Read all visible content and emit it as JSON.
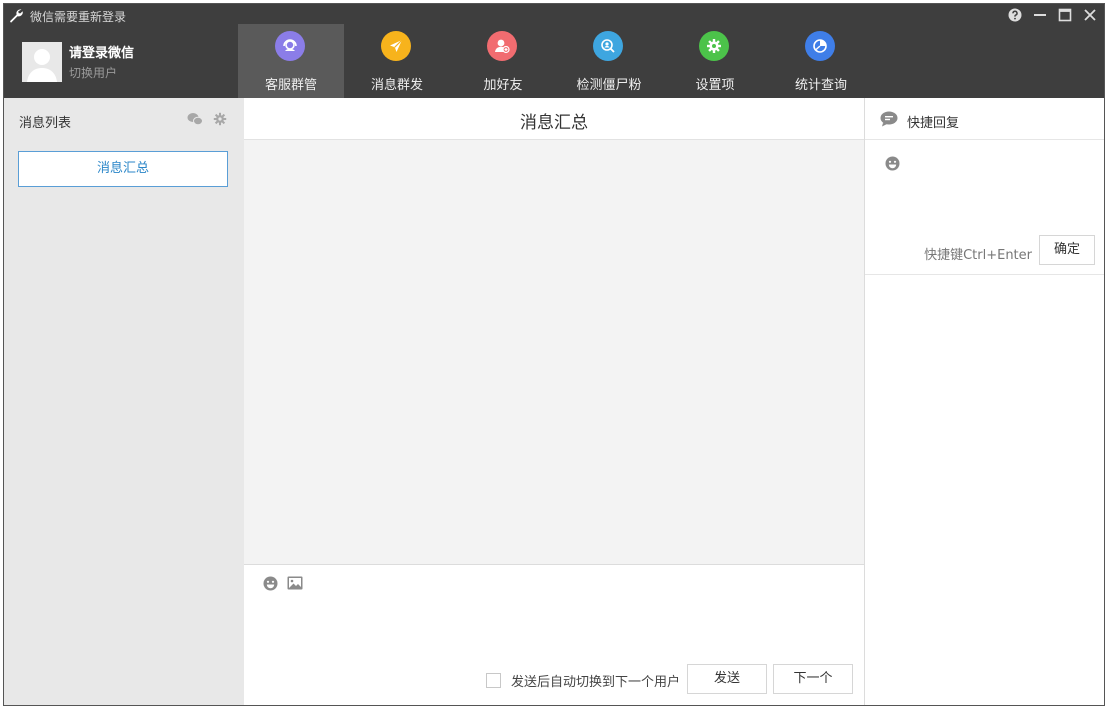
{
  "window": {
    "title": "微信需要重新登录",
    "controls": [
      "help-icon",
      "minimize-icon",
      "maximize-icon",
      "close-icon"
    ]
  },
  "user": {
    "name": "请登录微信",
    "switch_label": "切换用户"
  },
  "nav": {
    "items": [
      {
        "label": "客服群管",
        "icon": "customer-service-icon",
        "color": "#8b7de8",
        "active": true
      },
      {
        "label": "消息群发",
        "icon": "paper-plane-icon",
        "color": "#f7b31c"
      },
      {
        "label": "加好友",
        "icon": "add-user-icon",
        "color": "#f16c70"
      },
      {
        "label": "检测僵尸粉",
        "icon": "detect-icon",
        "color": "#3ea6e0"
      },
      {
        "label": "设置项",
        "icon": "gear-icon",
        "color": "#4cc34a"
      },
      {
        "label": "统计查询",
        "icon": "pie-chart-icon",
        "color": "#3f7ee8"
      }
    ]
  },
  "left_panel": {
    "title": "消息列表",
    "summary_button": "消息汇总"
  },
  "center": {
    "title": "消息汇总",
    "auto_switch_label": "发送后自动切换到下一个用户",
    "send_label": "发送",
    "next_label": "下一个"
  },
  "right_panel": {
    "title": "快捷回复",
    "hotkey_label": "快捷键Ctrl+Enter",
    "confirm_label": "确定"
  },
  "colors": {
    "header_bg": "#3e3e3e",
    "accent": "#2a86c8"
  }
}
